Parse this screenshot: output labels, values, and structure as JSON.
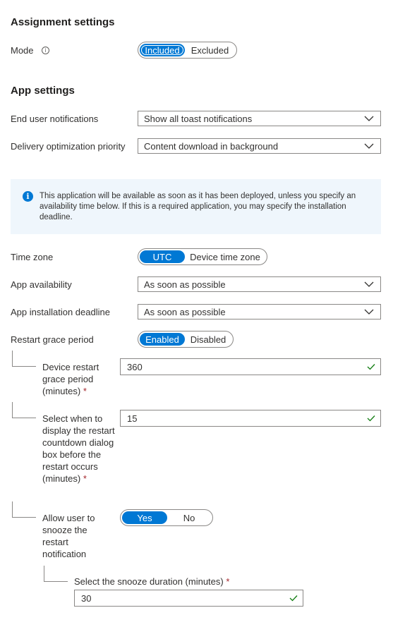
{
  "assignment_settings": {
    "title": "Assignment settings",
    "mode_label": "Mode",
    "mode_options": [
      "Included",
      "Excluded"
    ],
    "mode_selected": "Included"
  },
  "app_settings": {
    "title": "App settings",
    "end_user_notifications_label": "End user notifications",
    "end_user_notifications_value": "Show all toast notifications",
    "delivery_optimization_label": "Delivery optimization priority",
    "delivery_optimization_value": "Content download in background"
  },
  "info_banner": {
    "text": "This application will be available as soon as it has been deployed, unless you specify an availability time below. If this is a required application, you may specify the installation deadline."
  },
  "time_zone": {
    "label": "Time zone",
    "options": [
      "UTC",
      "Device time zone"
    ],
    "selected": "UTC"
  },
  "app_availability": {
    "label": "App availability",
    "value": "As soon as possible"
  },
  "app_installation_deadline": {
    "label": "App installation deadline",
    "value": "As soon as possible"
  },
  "restart_grace_period": {
    "label": "Restart grace period",
    "options": [
      "Enabled",
      "Disabled"
    ],
    "selected": "Enabled"
  },
  "device_restart_grace": {
    "label": "Device restart grace period (minutes)",
    "required": "*",
    "value": "360"
  },
  "countdown_dialog": {
    "label": "Select when to display the restart countdown dialog box before the restart occurs (minutes)",
    "required": "*",
    "value": "15"
  },
  "allow_snooze": {
    "label": "Allow user to snooze the restart notification",
    "options": [
      "Yes",
      "No"
    ],
    "selected": "Yes"
  },
  "snooze_duration": {
    "label": "Select the snooze duration (minutes)",
    "required": "*",
    "value": "30"
  },
  "icons": {
    "info": "info-icon",
    "chevron": "chevron-down-icon",
    "valid": "checkmark-icon"
  },
  "colors": {
    "accent": "#0078d4",
    "valid": "#107c10",
    "required": "#a4262c",
    "banner_bg": "#eff6fc"
  }
}
